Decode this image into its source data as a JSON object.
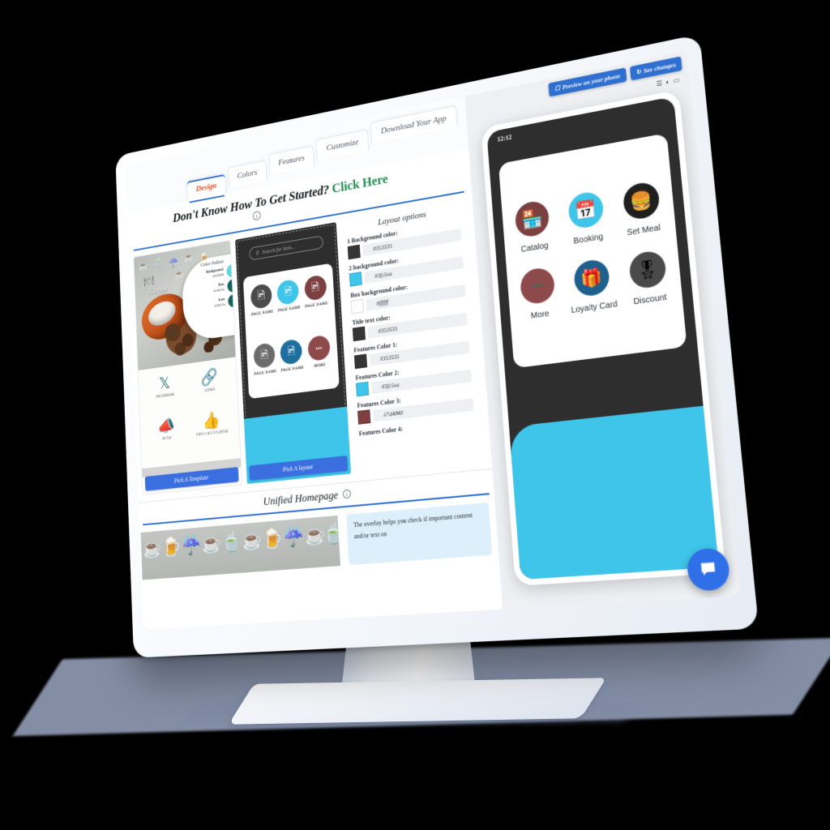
{
  "topbar": {
    "preview_button": "Preview on your phone",
    "preview_icon": "phone-icon",
    "see_changes_button": "See changes",
    "refresh_icon": "refresh-icon"
  },
  "tabs": [
    {
      "label": "Design",
      "active": true
    },
    {
      "label": "Colors",
      "active": false
    },
    {
      "label": "Features",
      "active": false
    },
    {
      "label": "Customize",
      "active": false
    },
    {
      "label": "Download Your App",
      "active": false
    }
  ],
  "get_started": {
    "question": "Don't Know How To Get Started?",
    "link": "Click Here",
    "info_icon": "ⓘ"
  },
  "template_panel": {
    "coffee_word": "Coffee",
    "palette_title": "Color Pallete",
    "palette": [
      {
        "label": "Background",
        "value": "#61d5d9",
        "swatch": "#62d6dd"
      },
      {
        "label": "Text",
        "value": "#10615a",
        "swatch": "#12655e"
      },
      {
        "label": "Icon",
        "value": "#10615a",
        "swatch": "#12655e"
      }
    ],
    "features": [
      {
        "label": "FACEBOOK",
        "icon": "facebook-icon",
        "glyph": "𝐇"
      },
      {
        "label": "LINKS",
        "icon": "link-icon",
        "glyph": "🔗"
      },
      {
        "label": "PUSH",
        "icon": "megaphone-icon",
        "glyph": "📣"
      },
      {
        "label": "TIPS CALCULATOR",
        "icon": "thumbs-up-icon",
        "glyph": "👍"
      }
    ],
    "pick_button": "Pick A Template"
  },
  "layout_panel": {
    "search_placeholder": "Search for item...",
    "search_icon": "search-icon",
    "tiles": [
      {
        "label": "PAGE NAME",
        "color": "#4b4b4b",
        "icon": "image-icon",
        "glyph": "🖼"
      },
      {
        "label": "PAGE NAME",
        "color": "#3fc5ea",
        "icon": "image-icon",
        "glyph": "🖼"
      },
      {
        "label": "PAGE NAME",
        "color": "#7d4040",
        "icon": "image-icon",
        "glyph": "🖼"
      },
      {
        "label": "PAGE NAME",
        "color": "#6b6b6b",
        "icon": "image-icon",
        "glyph": "🖼"
      },
      {
        "label": "PAGE NAME",
        "color": "#1f6f9e",
        "icon": "image-icon",
        "glyph": "🖼"
      },
      {
        "label": "MORE",
        "color": "#8d4a4a",
        "icon": "ellipsis-icon",
        "glyph": "•••"
      }
    ],
    "pick_button": "Pick A layout"
  },
  "layout_options": {
    "title": "Layout options",
    "fields": [
      {
        "label": "1 Background color:",
        "value": "#353535",
        "swatch": "#353535"
      },
      {
        "label": "2 background color:",
        "value": "#3fc5ea",
        "swatch": "#3fc5ea"
      },
      {
        "label": "Box background color:",
        "value": "#ffffff",
        "swatch": "#ffffff"
      },
      {
        "label": "Title text color:",
        "value": "#353535",
        "swatch": "#353535"
      },
      {
        "label": "Features Color 1:",
        "value": "#353535",
        "swatch": "#353535"
      },
      {
        "label": "Features Color 2:",
        "value": "#3fc5ea",
        "swatch": "#3fc5ea"
      },
      {
        "label": "Features Color 3:",
        "value": "#7d4040",
        "swatch": "#7d4040"
      },
      {
        "label": "Features Color 4:",
        "value": "",
        "swatch": "#6b6b6b"
      }
    ]
  },
  "unified": {
    "title": "Unified Homepage",
    "info_icon": "ⓘ",
    "overlay_tip": "The overlay helps you check if important content and/or text on"
  },
  "phone": {
    "time": "12:12",
    "signal_icon": "signal-icon",
    "wifi_icon": "wifi-icon",
    "battery_icon": "battery-icon",
    "tiles": [
      {
        "label": "Catalog",
        "color": "#7d4040",
        "icon": "catalog-icon",
        "glyph": "🏪"
      },
      {
        "label": "Booking",
        "color": "#3fc5ea",
        "icon": "calendar-icon",
        "glyph": "📅"
      },
      {
        "label": "Set Meal",
        "color": "#1f1f1f",
        "icon": "burger-icon",
        "glyph": "🍔"
      },
      {
        "label": "More",
        "color": "#8d4a4a",
        "icon": "ellipsis-icon",
        "glyph": "•••"
      },
      {
        "label": "Loyalty Card",
        "color": "#1f5f8e",
        "icon": "loyalty-card-icon",
        "glyph": "🎁"
      },
      {
        "label": "Discount",
        "color": "#4a4a4a",
        "icon": "award-icon",
        "glyph": "🎖"
      }
    ],
    "accent_color": "#3fc5ea"
  },
  "chat": {
    "icon": "chat-bubble-icon",
    "color": "#2f6fe8"
  }
}
